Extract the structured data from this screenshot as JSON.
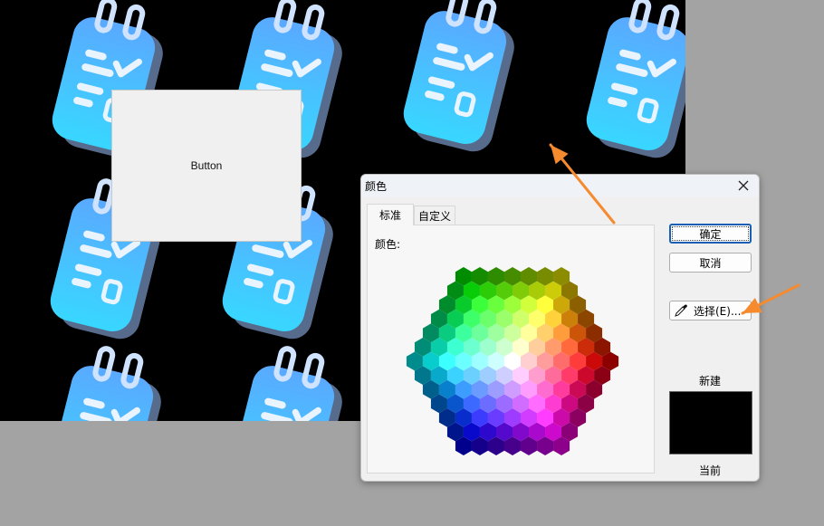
{
  "app": {
    "button_label": "Button",
    "background_color": "#000000",
    "desktop_color": "#a3a3a3"
  },
  "wallpaper": {
    "icon": "notepad-checklist-icon",
    "colors": {
      "top": "#5aa9ff",
      "bottom": "#38d7ff",
      "rings": "#cfe3ff"
    }
  },
  "dialog": {
    "title": "颜色",
    "tabs": [
      {
        "label": "标准",
        "selected": true
      },
      {
        "label": "自定义",
        "selected": false
      }
    ],
    "colors_label": "颜色:",
    "buttons": {
      "ok": "确定",
      "cancel": "取消",
      "pick": "选择(E)..."
    },
    "new_label": "新建",
    "current_label": "当前",
    "new_color": "#000000",
    "current_color": "#000000",
    "accent": "#1a5fb4"
  },
  "annotations": {
    "arrow_color": "#f58a2e"
  }
}
